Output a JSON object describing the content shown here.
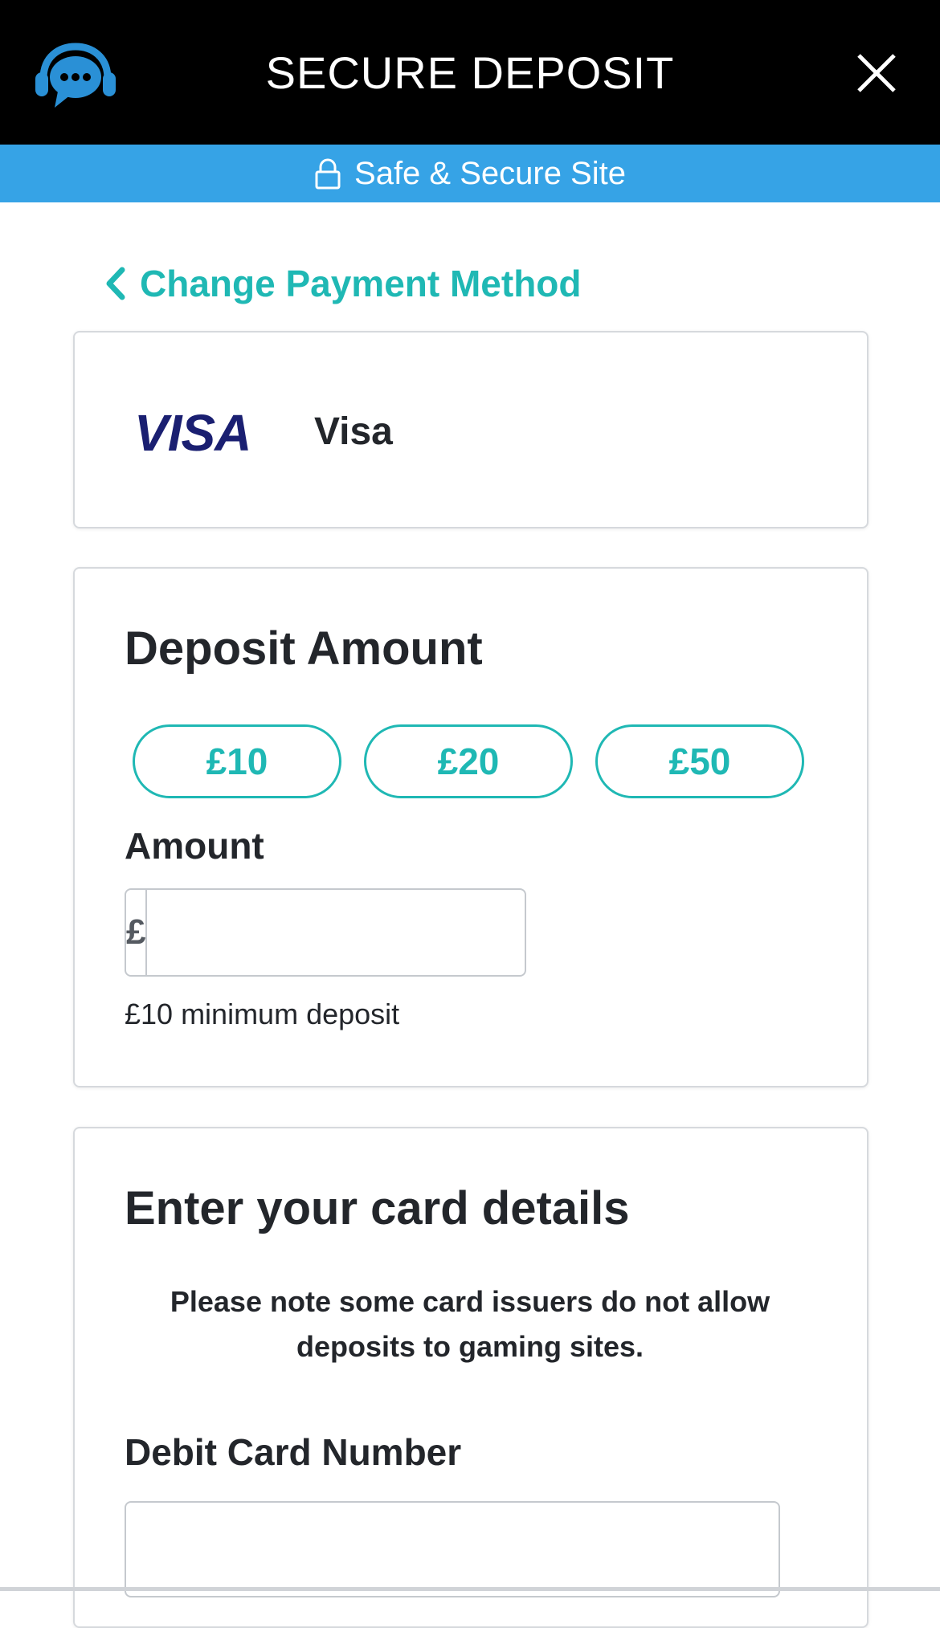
{
  "header": {
    "title": "SECURE DEPOSIT",
    "support_icon": "headset-chat-icon",
    "close_icon": "close-icon"
  },
  "secure_banner": {
    "icon": "lock-icon",
    "text": "Safe & Secure Site"
  },
  "back_link": {
    "icon": "chevron-left-icon",
    "label": "Change Payment Method"
  },
  "payment_method": {
    "logo_text": "VISA",
    "name": "Visa"
  },
  "deposit": {
    "heading": "Deposit Amount",
    "quick_amounts": [
      "£10",
      "£20",
      "£50"
    ],
    "amount_label": "Amount",
    "currency_prefix": "£",
    "amount_value": "",
    "helper": "£10 minimum deposit"
  },
  "card_details": {
    "heading": "Enter your card details",
    "note": "Please note some card issuers do not allow deposits to gaming sites.",
    "card_number_label": "Debit Card Number",
    "card_number_value": ""
  },
  "colors": {
    "header_bg": "#000000",
    "banner_bg": "#36a3e6",
    "accent": "#1fb8b4",
    "visa_blue": "#1a1f71",
    "support_icon": "#2a90d6"
  }
}
